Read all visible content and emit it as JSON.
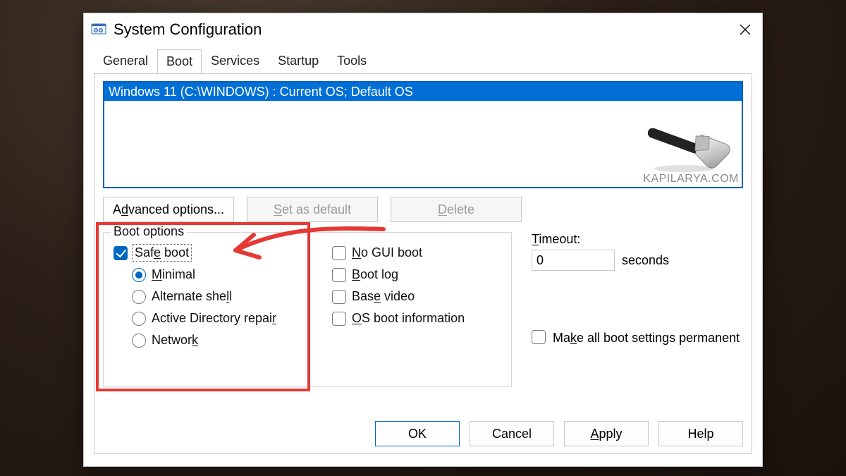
{
  "window": {
    "title": "System Configuration"
  },
  "tabs": {
    "items": [
      {
        "label": "General"
      },
      {
        "label": "Boot"
      },
      {
        "label": "Services"
      },
      {
        "label": "Startup"
      },
      {
        "label": "Tools"
      }
    ],
    "active_index": 1
  },
  "os_list": {
    "entries": [
      "Windows 11 (C:\\WINDOWS) : Current OS; Default OS"
    ],
    "selected_index": 0
  },
  "watermark": "KAPILARYA.COM",
  "buttons_under_list": {
    "advanced": "Advanced options...",
    "set_default": "Set as default",
    "delete": "Delete"
  },
  "boot_options": {
    "legend": "Boot options",
    "safe_boot": {
      "label": "Safe boot",
      "checked": true
    },
    "modes": {
      "selected": "minimal",
      "minimal": "Minimal",
      "alternate_shell": "Alternate shell",
      "ad_repair": "Active Directory repair",
      "network": "Network"
    },
    "no_gui_boot": {
      "label": "No GUI boot",
      "checked": false
    },
    "boot_log": {
      "label": "Boot log",
      "checked": false
    },
    "base_video": {
      "label": "Base video",
      "checked": false
    },
    "os_boot_info": {
      "label": "OS boot information",
      "checked": false
    }
  },
  "timeout": {
    "label": "Timeout:",
    "value": "0",
    "unit": "seconds"
  },
  "permanent": {
    "label": "Make all boot settings permanent",
    "checked": false
  },
  "dialog_buttons": {
    "ok": "OK",
    "cancel": "Cancel",
    "apply": "Apply",
    "help": "Help"
  }
}
